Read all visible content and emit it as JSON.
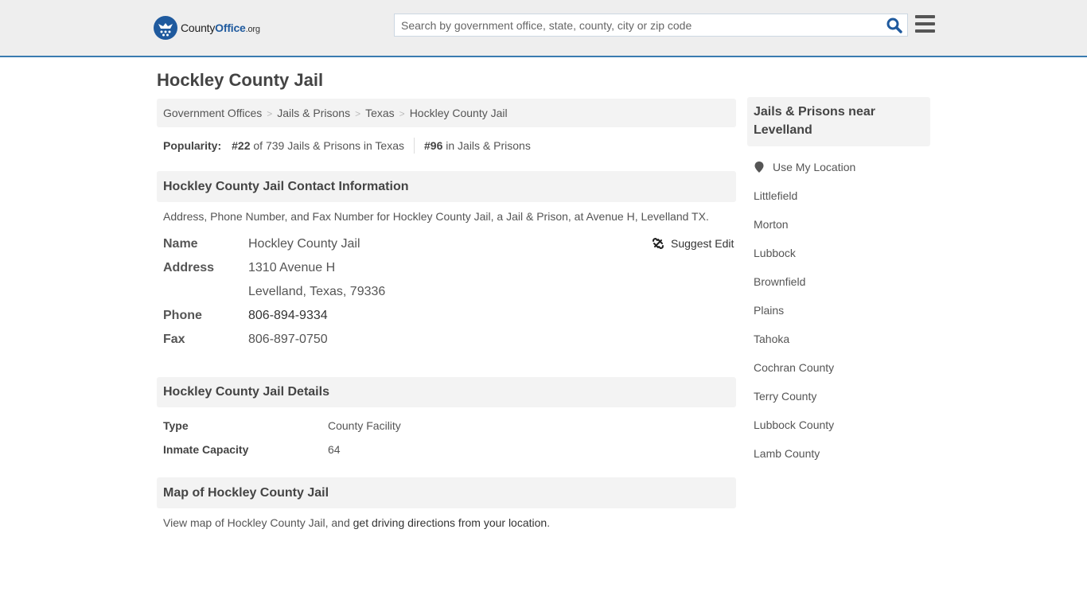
{
  "header": {
    "logo": {
      "brand_main": "County",
      "brand_accent": "Office",
      "brand_tld": ".org"
    },
    "search": {
      "placeholder": "Search by government office, state, county, city or zip code",
      "value": "",
      "icon": "search-icon"
    },
    "menu_icon": "hamburger-menu-icon",
    "accent_color": "#3a7bb0"
  },
  "page": {
    "title": "Hockley County Jail"
  },
  "breadcrumb": [
    {
      "label": "Government Offices"
    },
    {
      "label": "Jails & Prisons"
    },
    {
      "label": "Texas"
    },
    {
      "label": "Hockley County Jail"
    }
  ],
  "popularity": {
    "label": "Popularity:",
    "state_rank": "#22",
    "state_text": "of 739 Jails & Prisons in Texas",
    "national_rank": "#96",
    "national_text": "in Jails & Prisons"
  },
  "contact": {
    "heading": "Hockley County Jail Contact Information",
    "intro": "Address, Phone Number, and Fax Number for Hockley County Jail, a Jail & Prison, at Avenue H, Levelland TX.",
    "suggest_edit": "Suggest Edit",
    "fields": {
      "name_label": "Name",
      "name_value": "Hockley County Jail",
      "address_label": "Address",
      "address_line1": "1310 Avenue H",
      "address_line2": "Levelland, Texas, 79336",
      "phone_label": "Phone",
      "phone_value": "806-894-9334",
      "fax_label": "Fax",
      "fax_value": "806-897-0750"
    }
  },
  "details": {
    "heading": "Hockley County Jail Details",
    "rows": [
      {
        "label": "Type",
        "value": "County Facility"
      },
      {
        "label": "Inmate Capacity",
        "value": "64"
      }
    ]
  },
  "map": {
    "heading": "Map of Hockley County Jail",
    "text_before": "View map of Hockley County Jail, and ",
    "link": "get driving directions from your location",
    "text_after": "."
  },
  "sidebar": {
    "heading": "Jails & Prisons near Levelland",
    "use_location": "Use My Location",
    "links": [
      "Littlefield",
      "Morton",
      "Lubbock",
      "Brownfield",
      "Plains",
      "Tahoka",
      "Cochran County",
      "Terry County",
      "Lubbock County",
      "Lamb County"
    ]
  }
}
